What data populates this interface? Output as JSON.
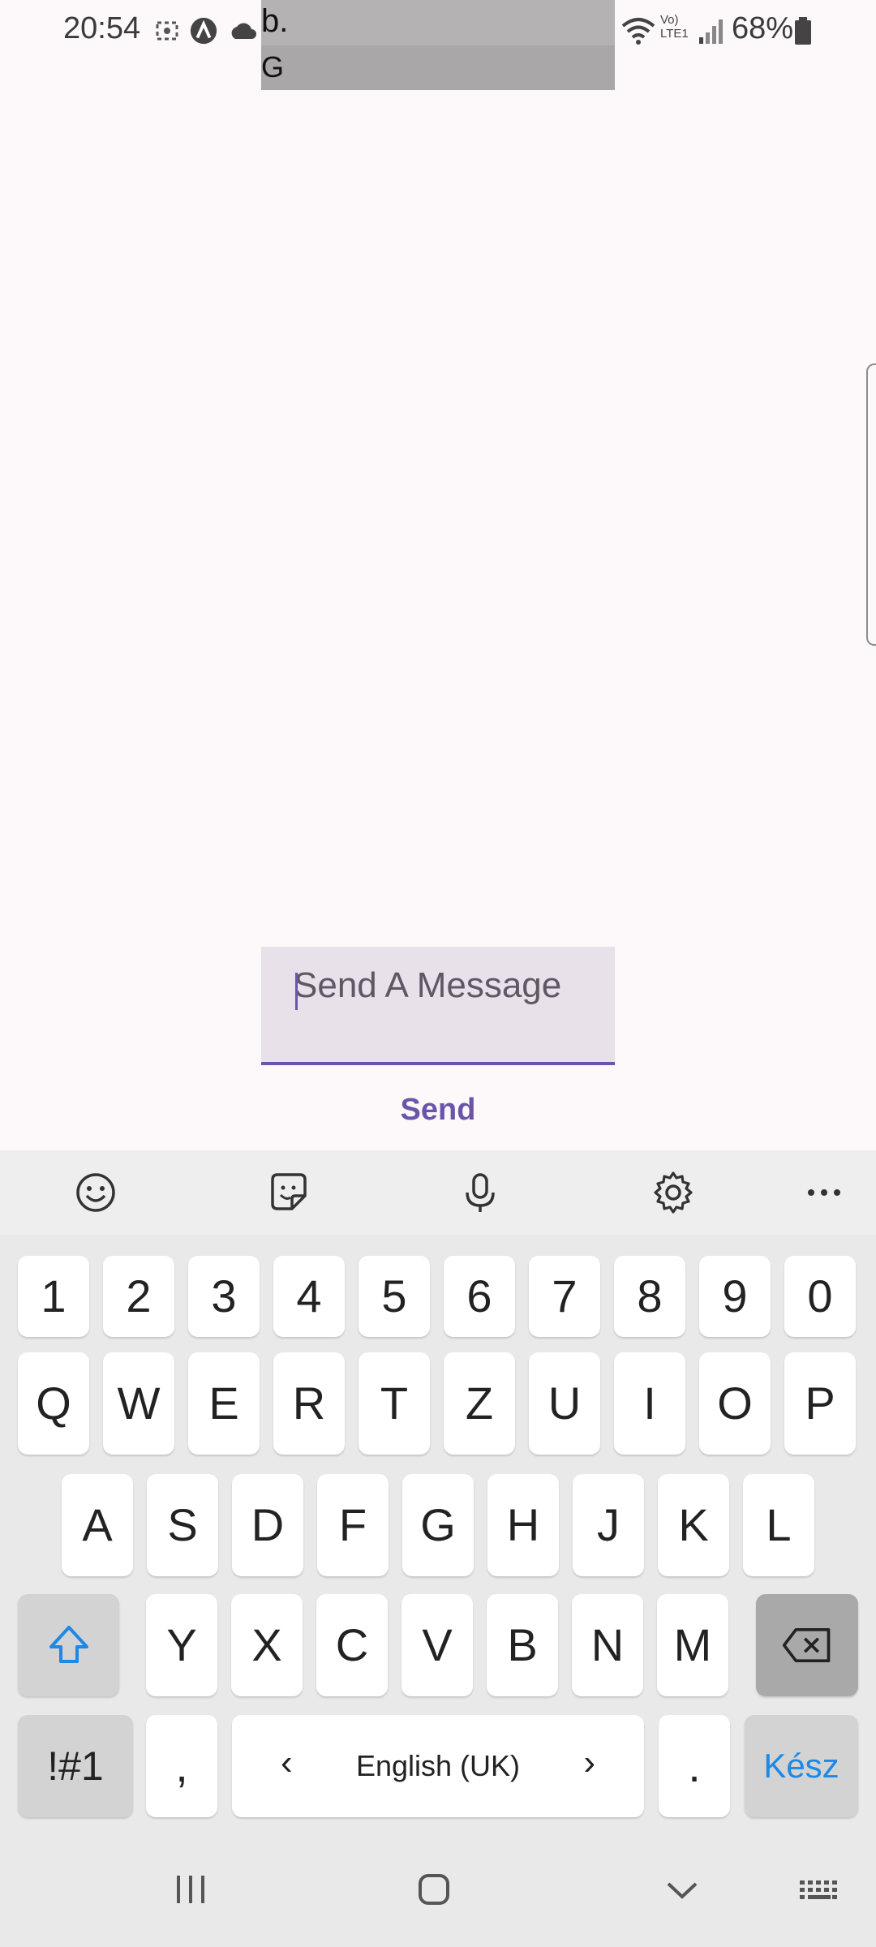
{
  "status_bar": {
    "time": "20:54",
    "battery": "68%",
    "network_label": "Vo) LTE1"
  },
  "top_block": {
    "line1": "b.",
    "line2": "G"
  },
  "message": {
    "placeholder": "Send A Message",
    "send_label": "Send"
  },
  "keyboard": {
    "toolbar": [
      "emoji-icon",
      "sticker-icon",
      "microphone-icon",
      "settings-icon",
      "more-icon"
    ],
    "row_numbers": [
      "1",
      "2",
      "3",
      "4",
      "5",
      "6",
      "7",
      "8",
      "9",
      "0"
    ],
    "row_1": [
      "Q",
      "W",
      "E",
      "R",
      "T",
      "Z",
      "U",
      "I",
      "O",
      "P"
    ],
    "row_2": [
      "A",
      "S",
      "D",
      "F",
      "G",
      "H",
      "J",
      "K",
      "L"
    ],
    "row_3": [
      "Y",
      "X",
      "C",
      "V",
      "B",
      "N",
      "M"
    ],
    "symbols_label": "!#1",
    "comma": ",",
    "space_label": "English (UK)",
    "period": ".",
    "done_label": "Kész",
    "accent_color": "#1e88e5"
  },
  "colors": {
    "primary": "#6a55a8",
    "input_bg": "#e8e1ea",
    "background": "#fdf8f9"
  }
}
